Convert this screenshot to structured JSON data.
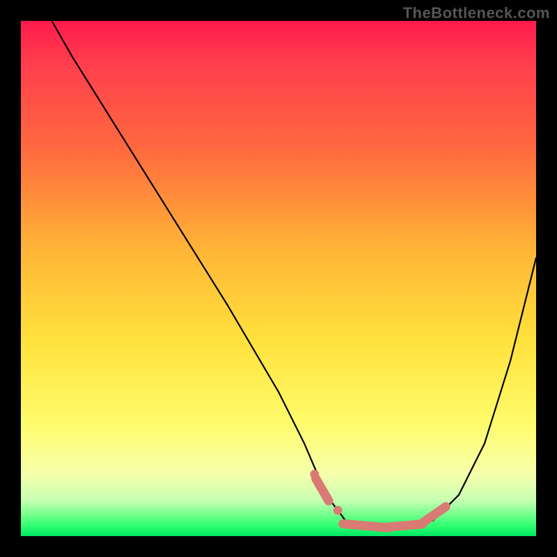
{
  "watermark": "TheBottleneck.com",
  "chart_data": {
    "type": "line",
    "title": "",
    "xlabel": "",
    "ylabel": "",
    "xlim": [
      0,
      100
    ],
    "ylim": [
      0,
      100
    ],
    "series": [
      {
        "name": "curve",
        "color": "#000000",
        "x": [
          6,
          10,
          20,
          30,
          40,
          50,
          55,
          58,
          60,
          63,
          66,
          70,
          75,
          80,
          85,
          90,
          95,
          100
        ],
        "y": [
          100,
          93,
          77,
          61,
          45,
          28,
          18,
          11,
          7,
          3,
          1.5,
          1,
          1.5,
          3,
          8,
          18,
          34,
          54
        ]
      }
    ],
    "markers": [
      {
        "name": "valley-marker",
        "color": "#d97a74",
        "x": 57,
        "y": 12,
        "shape": "dot",
        "r": 4
      },
      {
        "name": "valley-marker",
        "color": "#d97a74",
        "x": 58.5,
        "y": 9,
        "shape": "pill",
        "len": 5,
        "angle": -60
      },
      {
        "name": "valley-marker",
        "color": "#d97a74",
        "x": 61.5,
        "y": 5,
        "shape": "dot",
        "r": 4
      },
      {
        "name": "valley-marker",
        "color": "#d97a74",
        "x": 67,
        "y": 2,
        "shape": "pill",
        "len": 9,
        "angle": -5
      },
      {
        "name": "valley-marker",
        "color": "#d97a74",
        "x": 74,
        "y": 2,
        "shape": "pill",
        "len": 8,
        "angle": 5
      },
      {
        "name": "valley-marker",
        "color": "#d97a74",
        "x": 80,
        "y": 4,
        "shape": "pill",
        "len": 6,
        "angle": 35
      }
    ]
  }
}
